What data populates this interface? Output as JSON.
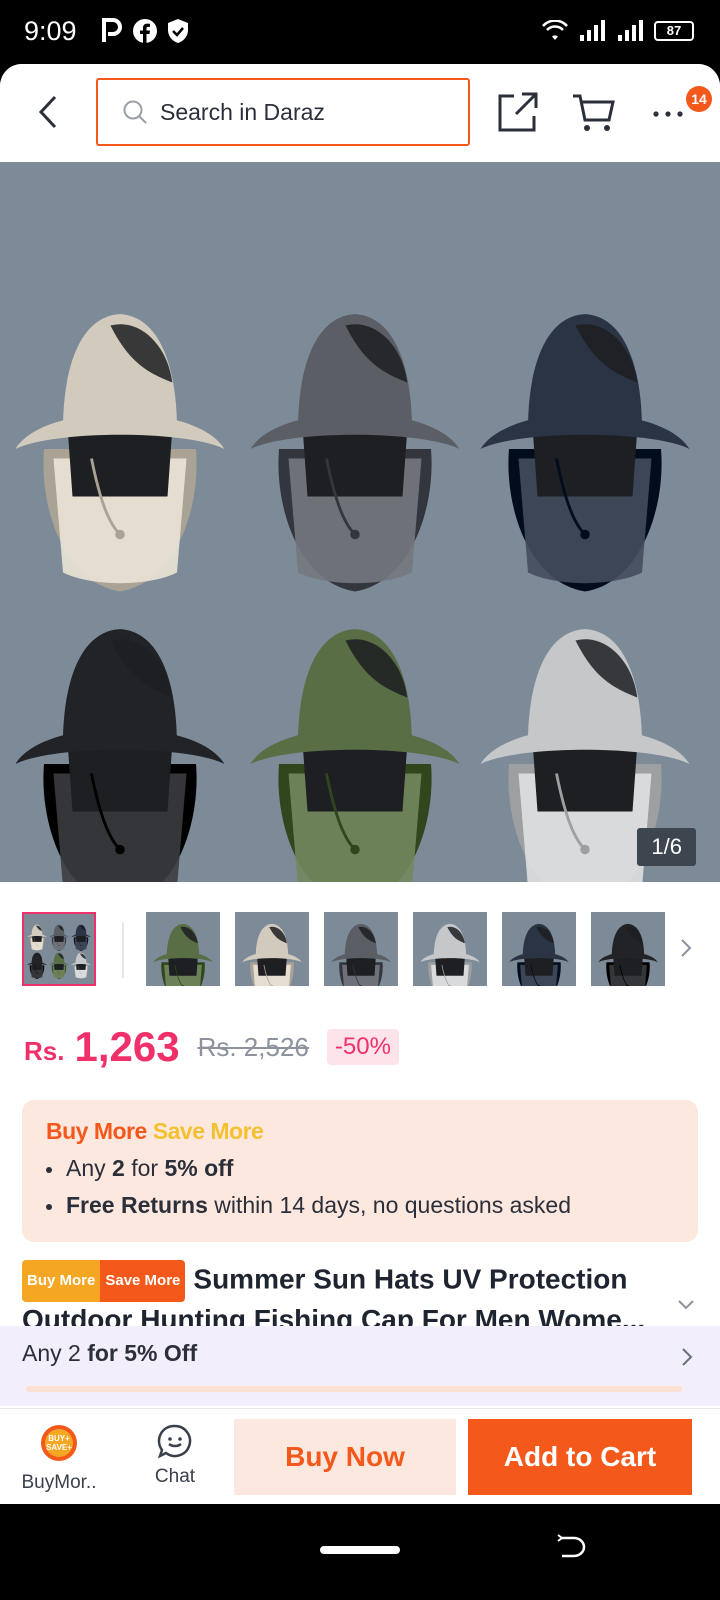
{
  "status_bar": {
    "time": "9:09",
    "battery": "87"
  },
  "header": {
    "search_placeholder": "Search in Daraz",
    "cart_badge": "14"
  },
  "gallery": {
    "counter": "1/6",
    "hat_colors": [
      "#d2cbbd",
      "#5b5f65",
      "#2b3445",
      "#222326",
      "#5a6e46",
      "#c6c7c9"
    ],
    "thumb_colors": [
      "grid",
      "#5a6e46",
      "#d2cbbd",
      "#5b5f65",
      "#c6c7c9",
      "#2b3445",
      "#222326"
    ]
  },
  "price": {
    "currency": "Rs.",
    "current": "1,263",
    "original": "Rs. 2,526",
    "discount": "-50%"
  },
  "promo": {
    "title_buy": "Buy More",
    "title_save": "Save More",
    "line1_prefix": "Any ",
    "line1_qty": "2",
    "line1_mid": " for ",
    "line1_off": "5% off",
    "line2_bold": "Free Returns",
    "line2_rest": " within 14 days, no questions asked"
  },
  "product": {
    "tag_buy": "Buy More",
    "tag_save": "Save More",
    "title": "Summer Sun Hats UV Protection Outdoor Hunting Fishing Cap For Men Wome..."
  },
  "deal": {
    "prefix": "Any 2 ",
    "bold": "for 5% Off"
  },
  "bottom_bar": {
    "buymore_label": "BuyMor..",
    "buymore_icon_text": "BUY+ SAVE+",
    "chat_label": "Chat",
    "buy_now": "Buy Now",
    "add_to_cart": "Add to Cart"
  },
  "colors": {
    "accent": "#f5581b",
    "price": "#f0306a"
  }
}
